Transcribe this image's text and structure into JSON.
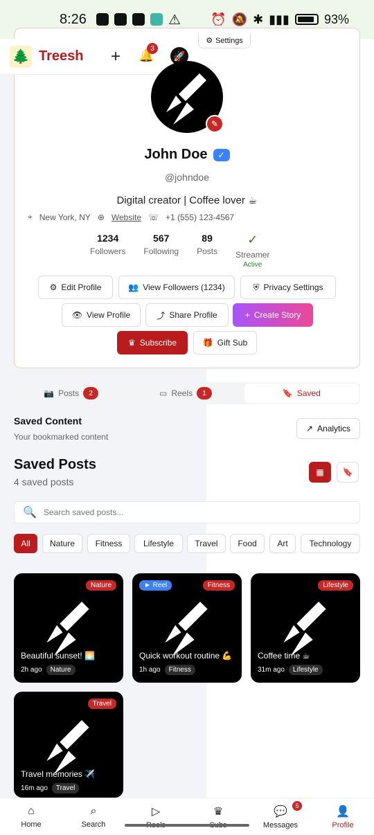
{
  "status_bar": {
    "time": "8:26",
    "battery": "93%"
  },
  "app": {
    "brand": "Treesh",
    "notifications": "3",
    "settings_label": "Settings"
  },
  "profile": {
    "name": "John Doe",
    "handle": "@johndoe",
    "bio": "Digital creator | Coffee lover ☕",
    "location": "New York, NY",
    "website": "Website",
    "phone": "+1 (555) 123-4567",
    "stats": [
      {
        "num": "1234",
        "label": "Followers"
      },
      {
        "num": "567",
        "label": "Following"
      },
      {
        "num": "89",
        "label": "Posts"
      }
    ],
    "streamer": {
      "label": "Streamer",
      "status": "Active"
    }
  },
  "actions": {
    "edit_profile": "Edit Profile",
    "view_followers": "View Followers (1234)",
    "privacy_settings": "Privacy Settings",
    "view_profile": "View Profile",
    "share_profile": "Share Profile",
    "create_story": "Create Story",
    "subscribe": "Subscribe",
    "gift_sub": "Gift Sub"
  },
  "tabs": [
    {
      "label": "Posts",
      "count": "2"
    },
    {
      "label": "Reels",
      "count": "1"
    },
    {
      "label": "Saved"
    }
  ],
  "saved": {
    "title": "Saved Content",
    "subtitle": "Your bookmarked content",
    "analytics": "Analytics",
    "posts_title": "Saved Posts",
    "posts_count": "4 saved posts",
    "search_placeholder": "Search saved posts..."
  },
  "filters": [
    "All",
    "Nature",
    "Fitness",
    "Lifestyle",
    "Travel",
    "Food",
    "Art",
    "Technology"
  ],
  "posts": [
    {
      "tag": "Nature",
      "caption": "Beautiful sunset! 🌅",
      "ago": "2h ago",
      "category": "Nature"
    },
    {
      "reel": "► Reel",
      "tag": "Fitness",
      "caption": "Quick workout routine 💪",
      "ago": "1h ago",
      "category": "Fitness"
    },
    {
      "tag": "Lifestyle",
      "caption": "Coffee time ☕",
      "ago": "31m ago",
      "category": "Lifestyle"
    },
    {
      "tag": "Travel",
      "caption": "Travel memories ✈️",
      "ago": "16m ago",
      "category": "Travel"
    }
  ],
  "bottom_nav": [
    {
      "label": "Home"
    },
    {
      "label": "Search"
    },
    {
      "label": "Reels"
    },
    {
      "label": "Subs"
    },
    {
      "label": "Messages",
      "badge": "5"
    },
    {
      "label": "Profile"
    }
  ]
}
